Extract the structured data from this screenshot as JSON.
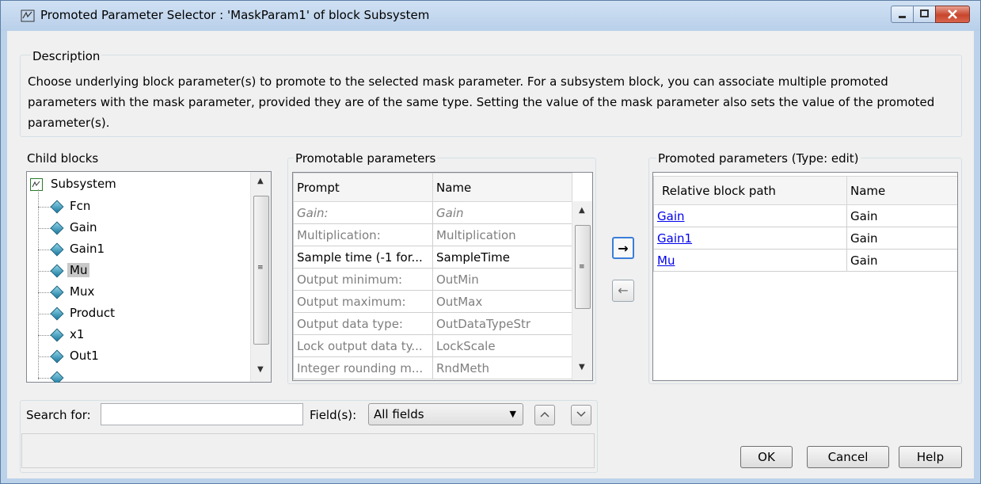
{
  "window": {
    "title": "Promoted Parameter Selector : 'MaskParam1' of block Subsystem"
  },
  "description": {
    "label": "Description",
    "text": "Choose underlying block parameter(s) to promote to the selected mask parameter. For a subsystem block, you can associate multiple promoted parameters with the mask parameter, provided they are of the same type. Setting the value of the mask parameter also sets the value of the promoted parameter(s)."
  },
  "child_blocks": {
    "label": "Child blocks",
    "root": "Subsystem",
    "items": [
      "Fcn",
      "Gain",
      "Gain1",
      "Mu",
      "Mux",
      "Product",
      "x1",
      "Out1"
    ],
    "selected": "Mu"
  },
  "promotable": {
    "label": "Promotable parameters",
    "columns": [
      "Prompt",
      "Name"
    ],
    "rows": [
      {
        "prompt": "Gain:",
        "name": "Gain"
      },
      {
        "prompt": "Multiplication:",
        "name": "Multiplication"
      },
      {
        "prompt": "Sample time (-1 for...",
        "name": "SampleTime"
      },
      {
        "prompt": "Output minimum:",
        "name": "OutMin"
      },
      {
        "prompt": "Output maximum:",
        "name": "OutMax"
      },
      {
        "prompt": "Output data type:",
        "name": "OutDataTypeStr"
      },
      {
        "prompt": "Lock output data ty...",
        "name": "LockScale"
      },
      {
        "prompt": "Integer rounding m...",
        "name": "RndMeth"
      }
    ]
  },
  "transfer": {
    "add_symbol": "→",
    "remove_symbol": "←"
  },
  "promoted": {
    "label": "Promoted parameters (Type: edit)",
    "columns": [
      "Relative block path",
      "Name"
    ],
    "rows": [
      {
        "path": "Gain",
        "name": "Gain"
      },
      {
        "path": "Gain1",
        "name": "Gain"
      },
      {
        "path": "Mu",
        "name": "Gain"
      }
    ]
  },
  "search": {
    "label": "Search for:",
    "value": "",
    "fields_label": "Field(s):",
    "fields_value": "All fields"
  },
  "buttons": {
    "ok": "OK",
    "cancel": "Cancel",
    "help": "Help"
  }
}
